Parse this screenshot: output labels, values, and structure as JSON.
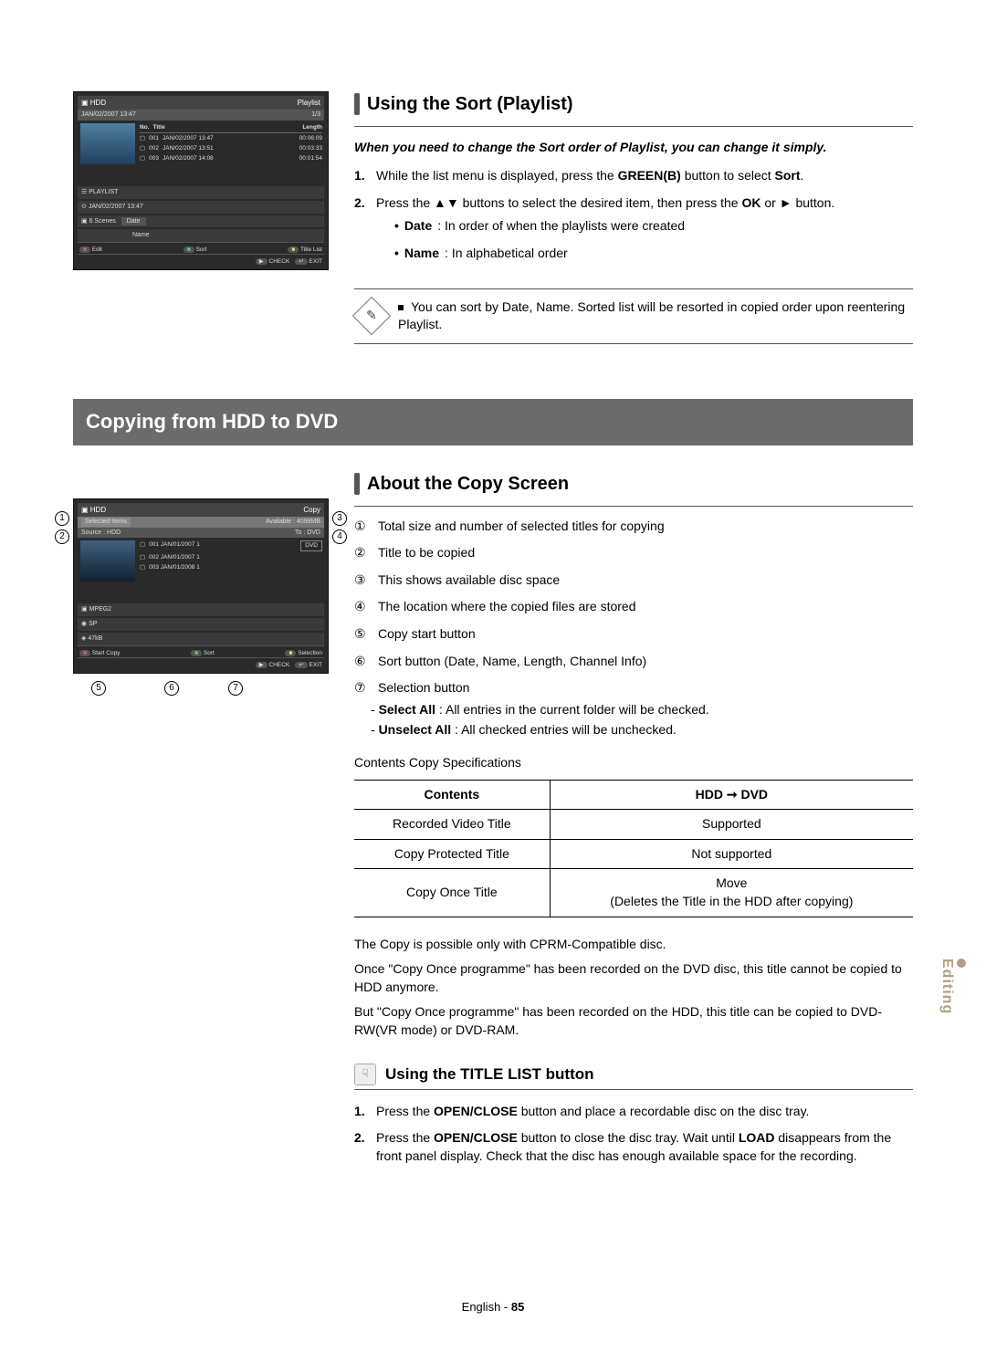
{
  "section1": {
    "title": "Using the Sort (Playlist)",
    "intro": "When you need to change the Sort order of Playlist, you can change it simply.",
    "step1_pre": "While the list menu is displayed, press the ",
    "step1_btn": "GREEN(B)",
    "step1_post": " button to select ",
    "step1_sort": "Sort",
    "step2_pre": "Press the ▲▼ buttons to select the desired item, then press the ",
    "step2_ok": "OK",
    "step2_post": " or ► button.",
    "bullet_date_label": "Date",
    "bullet_date_text": " : In order of when the playlists were created",
    "bullet_name_label": "Name",
    "bullet_name_text": " : In alphabetical order",
    "note": "You can sort by Date, Name. Sorted list will be resorted in copied order upon reentering Playlist."
  },
  "mainHeading": "Copying from HDD to DVD",
  "section2": {
    "title": "About the Copy Screen",
    "items": [
      {
        "n": "①",
        "t": "Total size and number of selected titles for copying"
      },
      {
        "n": "②",
        "t": "Title to be copied"
      },
      {
        "n": "③",
        "t": "This shows available disc space"
      },
      {
        "n": "④",
        "t": "The location where the copied files are stored"
      },
      {
        "n": "⑤",
        "t": "Copy start button"
      },
      {
        "n": "⑥",
        "t": "Sort button (Date, Name, Length, Channel Info)"
      }
    ],
    "item7_n": "⑦",
    "item7_t": "Selection button",
    "item7_sa_label": "Select All",
    "item7_sa_text": " : All entries in the current folder will be checked.",
    "item7_ua_label": "Unselect All",
    "item7_ua_text": " : All checked entries will be unchecked.",
    "tableCaption": "Contents Copy Specifications",
    "th1": "Contents",
    "th2": "HDD ➞ DVD",
    "r1c1": "Recorded Video Title",
    "r1c2": "Supported",
    "r2c1": "Copy Protected Title",
    "r2c2": "Not supported",
    "r3c1": "Copy Once Title",
    "r3c2a": "Move",
    "r3c2b": "(Deletes the Title in the HDD after copying)",
    "p1": "The Copy is possible only with CPRM-Compatible disc.",
    "p2": "Once \"Copy Once programme\" has been recorded on the DVD disc, this title cannot be copied to HDD anymore.",
    "p3": "But \"Copy Once programme\" has been recorded on the HDD, this title can be copied to DVD-RW(VR mode) or DVD-RAM."
  },
  "section3": {
    "title": "Using the TITLE LIST button",
    "s1_pre": "Press the ",
    "s1_btn": "OPEN/CLOSE",
    "s1_post": " button and place a recordable disc on the disc tray.",
    "s2_pre": "Press the ",
    "s2_btn": "OPEN/CLOSE",
    "s2_mid": " button to close the disc tray. Wait until ",
    "s2_load": "LOAD",
    "s2_post": " disappears from the front panel display. Check that the disc has enough available space for the recording."
  },
  "sideTab": "Editing",
  "footer_a": "English - ",
  "footer_b": "85",
  "shot1": {
    "hdd": "HDD",
    "mode": "Playlist",
    "time": "JAN/02/2007 13:47",
    "page": "1/3",
    "th_no": "No.",
    "th_title": "Title",
    "th_len": "Length",
    "r1_no": "001",
    "r1_t": "JAN/02/2007 13:47",
    "r1_l": "00:06:09",
    "r2_no": "002",
    "r2_t": "JAN/02/2007 13:51",
    "r2_l": "00:03:33",
    "r3_no": "003",
    "r3_t": "JAN/02/2007 14:08",
    "r3_l": "00:01:54",
    "p_playlist": "PLAYLIST",
    "p_time": "JAN/02/2007 13:47",
    "p_scenes": "6 Scenes",
    "opt_date": "Date",
    "opt_name": "Name",
    "b_edit": "Edit",
    "b_sort": "Sort",
    "b_title": "Title List",
    "b_check": "CHECK",
    "b_exit": "EXIT"
  },
  "shot2": {
    "hdd": "HDD",
    "mode": "Copy",
    "sel": "Selected Items",
    "avail": "Available : 4099MB",
    "src": "Source : HDD",
    "to": "To : DVD",
    "dvd": "DVD",
    "r1": "001 JAN/01/2007 1",
    "r2": "002 JAN/01/2007 1",
    "r3": "003 JAN/01/2008 1",
    "mpeg": "MPEG2",
    "sp": "SP",
    "size": "47kB",
    "b_start": "Start Copy",
    "b_sort": "Sort",
    "b_sel": "Selection",
    "b_check": "CHECK",
    "b_exit": "EXIT"
  }
}
